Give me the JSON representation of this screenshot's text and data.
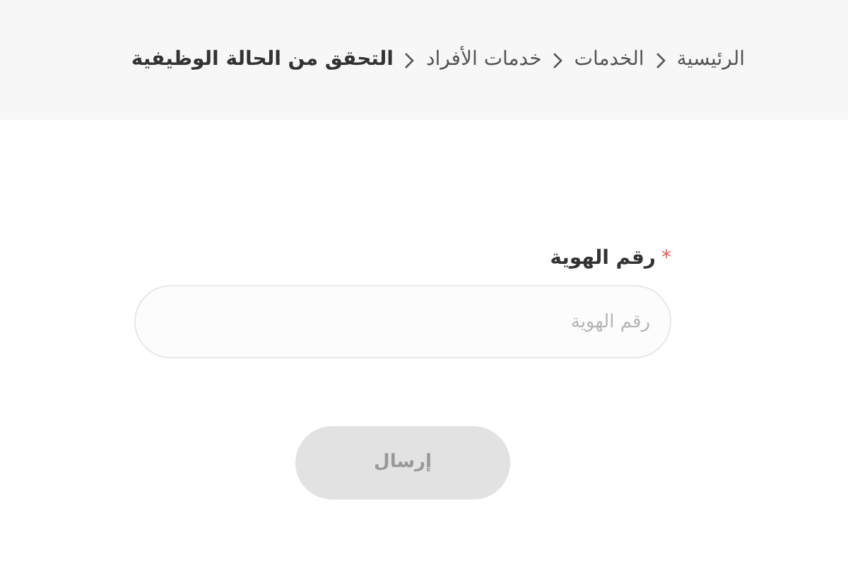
{
  "breadcrumb": [
    {
      "label": "الرئيسية",
      "current": false
    },
    {
      "label": "الخدمات",
      "current": false
    },
    {
      "label": "خدمات الأفراد",
      "current": false
    },
    {
      "label": "التحقق من الحالة الوظيفية",
      "current": true
    }
  ],
  "form": {
    "field": {
      "label": "رقم الهوية",
      "required_mark": "*",
      "placeholder": "رقم الهوية"
    },
    "submit": {
      "label": "إرسال",
      "disabled": true
    }
  }
}
